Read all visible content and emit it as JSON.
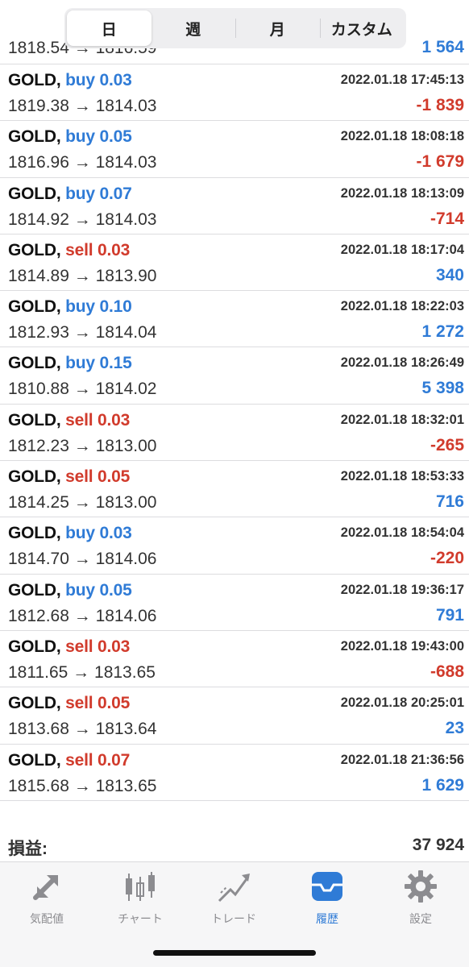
{
  "segments": [
    "日",
    "週",
    "月",
    "カスタム"
  ],
  "partial_row": {
    "prices": "1818.54 → 1816.59",
    "profit": "1 564"
  },
  "trades": [
    {
      "symbol": "GOLD,",
      "side": "buy",
      "volume": "0.03",
      "time": "2022.01.18 17:45:13",
      "prices": "1819.38 → 1814.03",
      "profit": "-1 839"
    },
    {
      "symbol": "GOLD,",
      "side": "buy",
      "volume": "0.05",
      "time": "2022.01.18 18:08:18",
      "prices": "1816.96 → 1814.03",
      "profit": "-1 679"
    },
    {
      "symbol": "GOLD,",
      "side": "buy",
      "volume": "0.07",
      "time": "2022.01.18 18:13:09",
      "prices": "1814.92 → 1814.03",
      "profit": "-714"
    },
    {
      "symbol": "GOLD,",
      "side": "sell",
      "volume": "0.03",
      "time": "2022.01.18 18:17:04",
      "prices": "1814.89 → 1813.90",
      "profit": "340"
    },
    {
      "symbol": "GOLD,",
      "side": "buy",
      "volume": "0.10",
      "time": "2022.01.18 18:22:03",
      "prices": "1812.93 → 1814.04",
      "profit": "1 272"
    },
    {
      "symbol": "GOLD,",
      "side": "buy",
      "volume": "0.15",
      "time": "2022.01.18 18:26:49",
      "prices": "1810.88 → 1814.02",
      "profit": "5 398"
    },
    {
      "symbol": "GOLD,",
      "side": "sell",
      "volume": "0.03",
      "time": "2022.01.18 18:32:01",
      "prices": "1812.23 → 1813.00",
      "profit": "-265"
    },
    {
      "symbol": "GOLD,",
      "side": "sell",
      "volume": "0.05",
      "time": "2022.01.18 18:53:33",
      "prices": "1814.25 → 1813.00",
      "profit": "716"
    },
    {
      "symbol": "GOLD,",
      "side": "buy",
      "volume": "0.03",
      "time": "2022.01.18 18:54:04",
      "prices": "1814.70 → 1814.06",
      "profit": "-220"
    },
    {
      "symbol": "GOLD,",
      "side": "buy",
      "volume": "0.05",
      "time": "2022.01.18 19:36:17",
      "prices": "1812.68 → 1814.06",
      "profit": "791"
    },
    {
      "symbol": "GOLD,",
      "side": "sell",
      "volume": "0.03",
      "time": "2022.01.18 19:43:00",
      "prices": "1811.65 → 1813.65",
      "profit": "-688"
    },
    {
      "symbol": "GOLD,",
      "side": "sell",
      "volume": "0.05",
      "time": "2022.01.18 20:25:01",
      "prices": "1813.68 → 1813.64",
      "profit": "23"
    },
    {
      "symbol": "GOLD,",
      "side": "sell",
      "volume": "0.07",
      "time": "2022.01.18 21:36:56",
      "prices": "1815.68 → 1813.65",
      "profit": "1 629"
    }
  ],
  "total": {
    "label": "損益:",
    "value": "37 924"
  },
  "tabs": [
    {
      "label": "気配値",
      "icon": "quotes-arrows-icon"
    },
    {
      "label": "チャート",
      "icon": "candlestick-chart-icon"
    },
    {
      "label": "トレード",
      "icon": "trade-line-icon"
    },
    {
      "label": "履歴",
      "icon": "history-tray-icon"
    },
    {
      "label": "設定",
      "icon": "gear-icon"
    }
  ],
  "colors": {
    "accent": "#2f7bd6",
    "negative": "#d13b2c",
    "inactive": "#8c8c90"
  }
}
